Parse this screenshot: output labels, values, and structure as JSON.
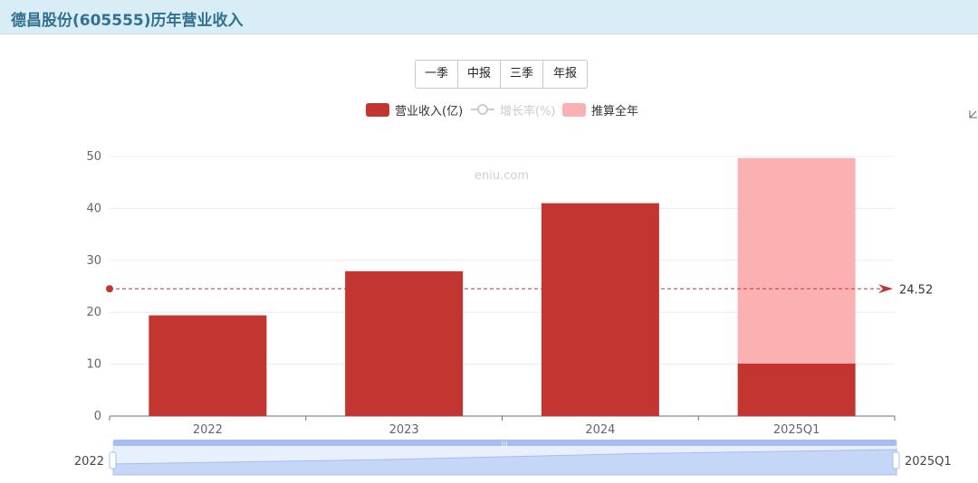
{
  "header": {
    "title": "德昌股份(605555)历年营业收入"
  },
  "tabs": [
    {
      "label": "一季"
    },
    {
      "label": "中报"
    },
    {
      "label": "三季"
    },
    {
      "label": "年报"
    }
  ],
  "legend": [
    {
      "label": "营业收入(亿)",
      "color": "#c23531",
      "active": true
    },
    {
      "label": "增长率(%)",
      "color": "#cccccc",
      "active": false
    },
    {
      "label": "推算全年",
      "color": "#fbb1b1",
      "active": true
    }
  ],
  "watermark": "eniu.com",
  "colors": {
    "revenue": "#c23531",
    "projection": "#fbb1b1",
    "average_line": "#c23531",
    "zoom_fill": "#d6e2fb",
    "zoom_handle": "#a7bdf1"
  },
  "chart_data": {
    "type": "bar",
    "categories": [
      "2022",
      "2023",
      "2024",
      "2025Q1"
    ],
    "series": [
      {
        "name": "营业收入(亿)",
        "values": [
          19.4,
          27.9,
          41.0,
          10.1
        ]
      },
      {
        "name": "推算全年",
        "values": [
          0,
          0,
          0,
          39.6
        ]
      }
    ],
    "ylim": [
      0,
      50
    ],
    "yticks": [
      0,
      10,
      20,
      30,
      40,
      50
    ],
    "average_line": {
      "value": 24.52,
      "label": "24.52"
    },
    "grid": true,
    "datazoom": {
      "start_label": "2022",
      "end_label": "2025Q1"
    }
  }
}
